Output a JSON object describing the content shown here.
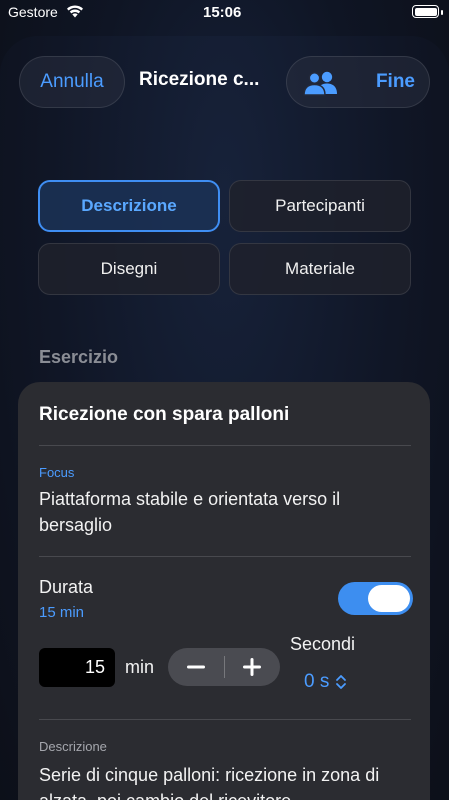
{
  "status_bar": {
    "carrier": "Gestore",
    "time": "15:06"
  },
  "nav": {
    "cancel_label": "Annulla",
    "title": "Ricezione c...",
    "done_label": "Fine"
  },
  "segments": {
    "description": "Descrizione",
    "participants": "Partecipanti",
    "drawings": "Disegni",
    "material": "Materiale"
  },
  "section_header": "Esercizio",
  "exercise": {
    "title": "Ricezione con spara palloni",
    "focus_label": "Focus",
    "focus_value": "Piattaforma stabile e orientata verso il bersaglio",
    "duration_label": "Durata",
    "duration_value": "15 min",
    "duration_enabled": true,
    "minutes_value": "15",
    "minutes_unit": "min",
    "seconds_label": "Secondi",
    "seconds_value": "0 s",
    "description_label": "Descrizione",
    "description_value": "Serie di cinque palloni: ricezione in zona di alzata, poi cambio del ricevitore."
  },
  "colors": {
    "accent": "#4b9cff",
    "card": "#2b2c31",
    "toggle_on": "#3d8ef0"
  },
  "icons": {
    "people": "people-icon",
    "wifi": "wifi-icon",
    "battery": "battery-icon",
    "minus": "minus-icon",
    "plus": "plus-icon",
    "chevron": "chevron-up-down-icon"
  }
}
